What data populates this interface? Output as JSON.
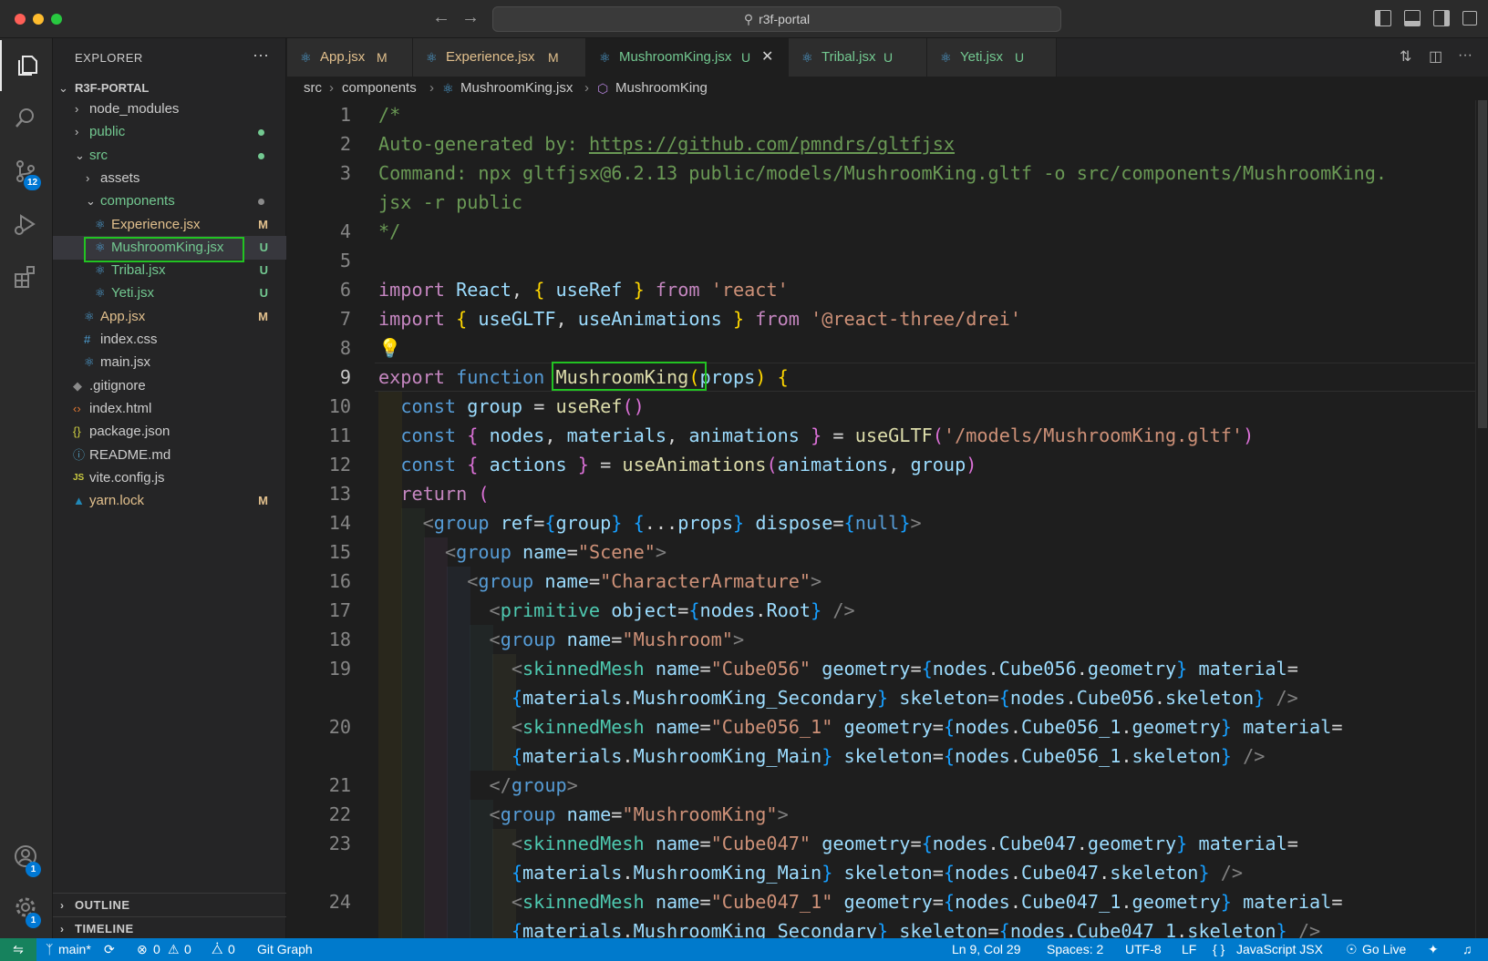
{
  "window": {
    "title": "r3f-portal"
  },
  "activity_bar": {
    "source_control_badge": "12",
    "accounts_badge": "1",
    "settings_badge": "1"
  },
  "sidebar": {
    "header": "EXPLORER",
    "more": "···",
    "root": "R3F-PORTAL",
    "tree": [
      {
        "label": "node_modules",
        "status": "",
        "color": "#cccccc"
      },
      {
        "label": "public",
        "status": "",
        "color": "#73c991"
      },
      {
        "label": "src",
        "status": "",
        "color": "#73c991"
      },
      {
        "label": "assets",
        "status": "",
        "color": "#cccccc"
      },
      {
        "label": "components",
        "status": "",
        "color": "#73c991"
      },
      {
        "label": "Experience.jsx",
        "status": "M",
        "color": "#e2c08d"
      },
      {
        "label": "MushroomKing.jsx",
        "status": "U",
        "color": "#73c991"
      },
      {
        "label": "Tribal.jsx",
        "status": "U",
        "color": "#73c991"
      },
      {
        "label": "Yeti.jsx",
        "status": "U",
        "color": "#73c991"
      },
      {
        "label": "App.jsx",
        "status": "M",
        "color": "#e2c08d"
      },
      {
        "label": "index.css",
        "status": "",
        "color": "#cccccc"
      },
      {
        "label": "main.jsx",
        "status": "",
        "color": "#cccccc"
      },
      {
        "label": ".gitignore",
        "status": "",
        "color": "#cccccc"
      },
      {
        "label": "index.html",
        "status": "",
        "color": "#cccccc"
      },
      {
        "label": "package.json",
        "status": "",
        "color": "#cccccc"
      },
      {
        "label": "README.md",
        "status": "",
        "color": "#cccccc"
      },
      {
        "label": "vite.config.js",
        "status": "",
        "color": "#cccccc"
      },
      {
        "label": "yarn.lock",
        "status": "M",
        "color": "#e2c08d"
      }
    ],
    "outline": "OUTLINE",
    "timeline": "TIMELINE"
  },
  "tabs": [
    {
      "label": "App.jsx",
      "status": "M",
      "color": "#e2c08d"
    },
    {
      "label": "Experience.jsx",
      "status": "M",
      "color": "#e2c08d"
    },
    {
      "label": "MushroomKing.jsx",
      "status": "U",
      "color": "#73c991",
      "active": true
    },
    {
      "label": "Tribal.jsx",
      "status": "U",
      "color": "#73c991"
    },
    {
      "label": "Yeti.jsx",
      "status": "U",
      "color": "#73c991"
    }
  ],
  "breadcrumb": {
    "a": "src",
    "b": "components",
    "c": "MushroomKing.jsx",
    "d": "MushroomKing"
  },
  "editor": {
    "line_numbers": [
      "1",
      "2",
      "3",
      "",
      "4",
      "5",
      "6",
      "7",
      "8",
      "9",
      "10",
      "11",
      "12",
      "13",
      "14",
      "15",
      "16",
      "17",
      "18",
      "19",
      "",
      "20",
      "",
      "21",
      "22",
      "23",
      "",
      "24"
    ],
    "current_line": "9"
  },
  "status_bar": {
    "branch": "main*",
    "errors": "0",
    "warnings": "0",
    "ports": "0",
    "git_graph": "Git Graph",
    "cursor": "Ln 9, Col 29",
    "spaces": "Spaces: 2",
    "encoding": "UTF-8",
    "eol": "LF",
    "language": "JavaScript JSX",
    "go_live": "Go Live"
  },
  "colors": {
    "accent": "#007acc",
    "modified": "#e2c08d",
    "untracked": "#73c991",
    "highlight": "#22c322"
  }
}
